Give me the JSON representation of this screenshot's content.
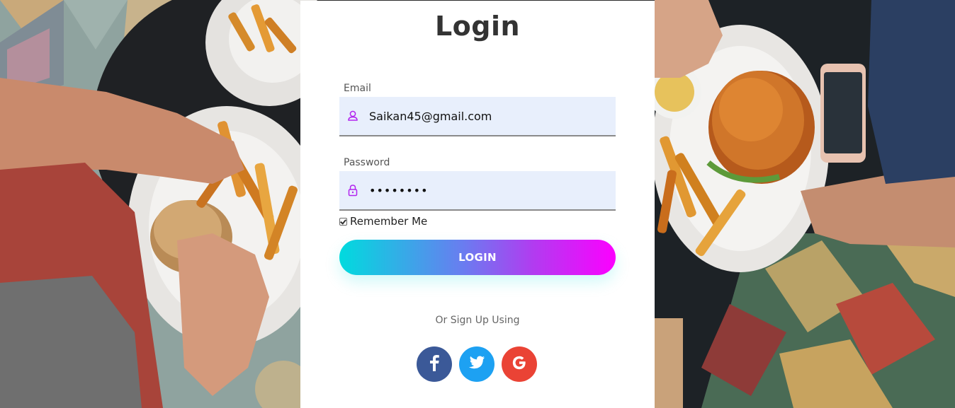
{
  "login": {
    "title": "Login",
    "email": {
      "label": "Email",
      "value": "Saikan45@gmail.com",
      "icon": "user-icon"
    },
    "password": {
      "label": "Password",
      "value": "••••••••",
      "icon": "lock-icon"
    },
    "remember": {
      "label": "Remember Me",
      "checked": true
    },
    "login_button": "LOGIN",
    "signup_text": "Or Sign Up Using",
    "social": [
      {
        "name": "facebook",
        "icon": "facebook-icon",
        "color": "#3b5998"
      },
      {
        "name": "twitter",
        "icon": "twitter-icon",
        "color": "#1da1f2"
      },
      {
        "name": "google",
        "icon": "google-icon",
        "color": "#ea4335"
      }
    ]
  },
  "colors": {
    "gradient_start": "#00dbde",
    "gradient_end": "#fc00ff",
    "input_bg": "#e8effc",
    "icon_accent": "#b224ef"
  }
}
